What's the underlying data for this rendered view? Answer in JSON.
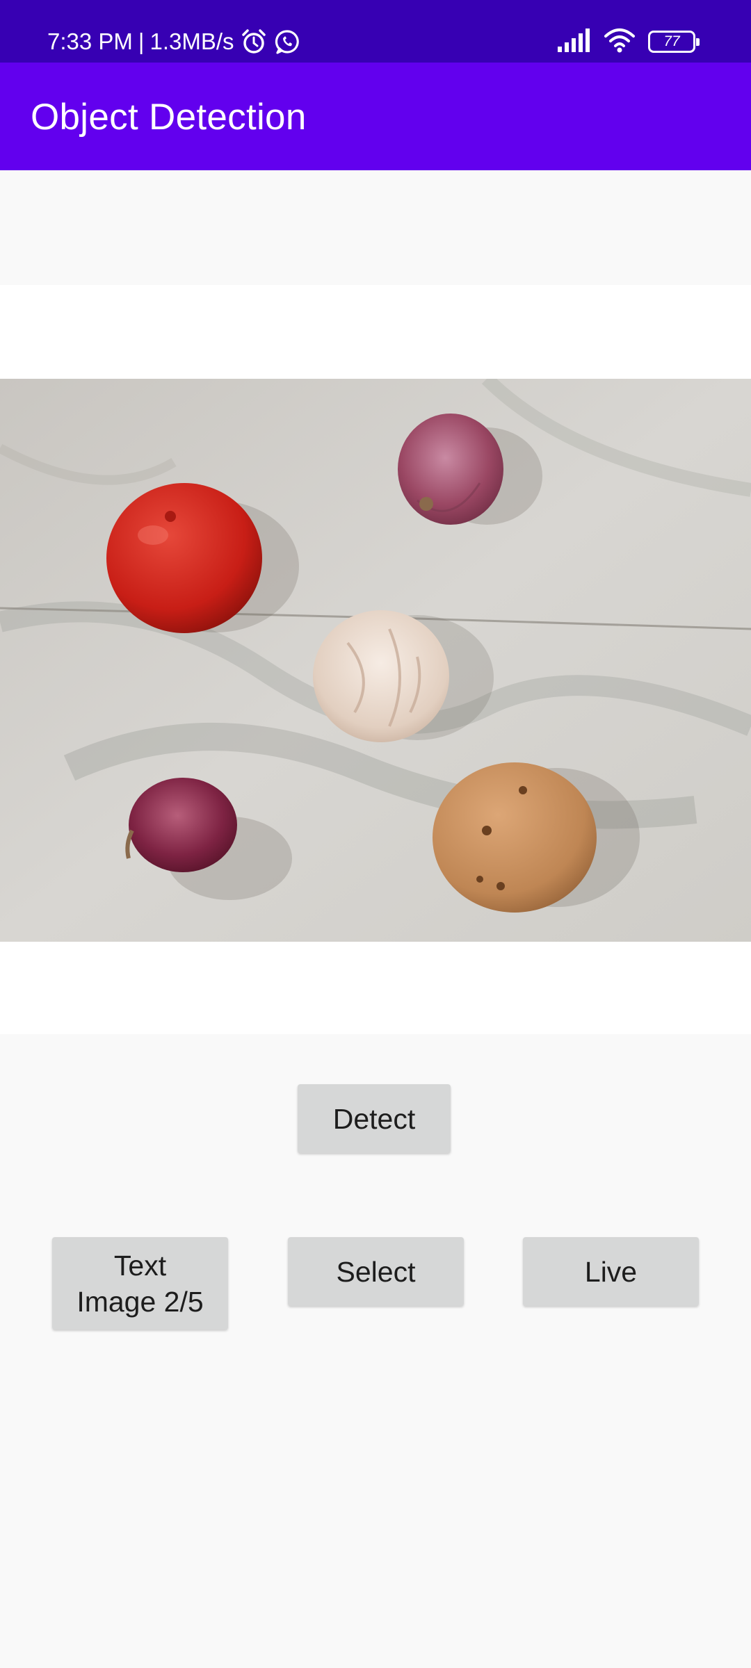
{
  "status_bar": {
    "time": "7:33 PM",
    "network_speed": "1.3MB/s",
    "battery_level": "77",
    "icons": [
      "alarm-icon",
      "whatsapp-icon",
      "signal-icon",
      "wifi-icon",
      "battery-icon"
    ]
  },
  "app_bar": {
    "title": "Object Detection",
    "color": "#6200ee"
  },
  "image_view": {
    "description_items": [
      "tomato",
      "onion",
      "garlic",
      "onion",
      "potato"
    ]
  },
  "buttons": {
    "detect": "Detect",
    "text_image": "Text\nImage 2/5",
    "select": "Select",
    "live": "Live"
  }
}
